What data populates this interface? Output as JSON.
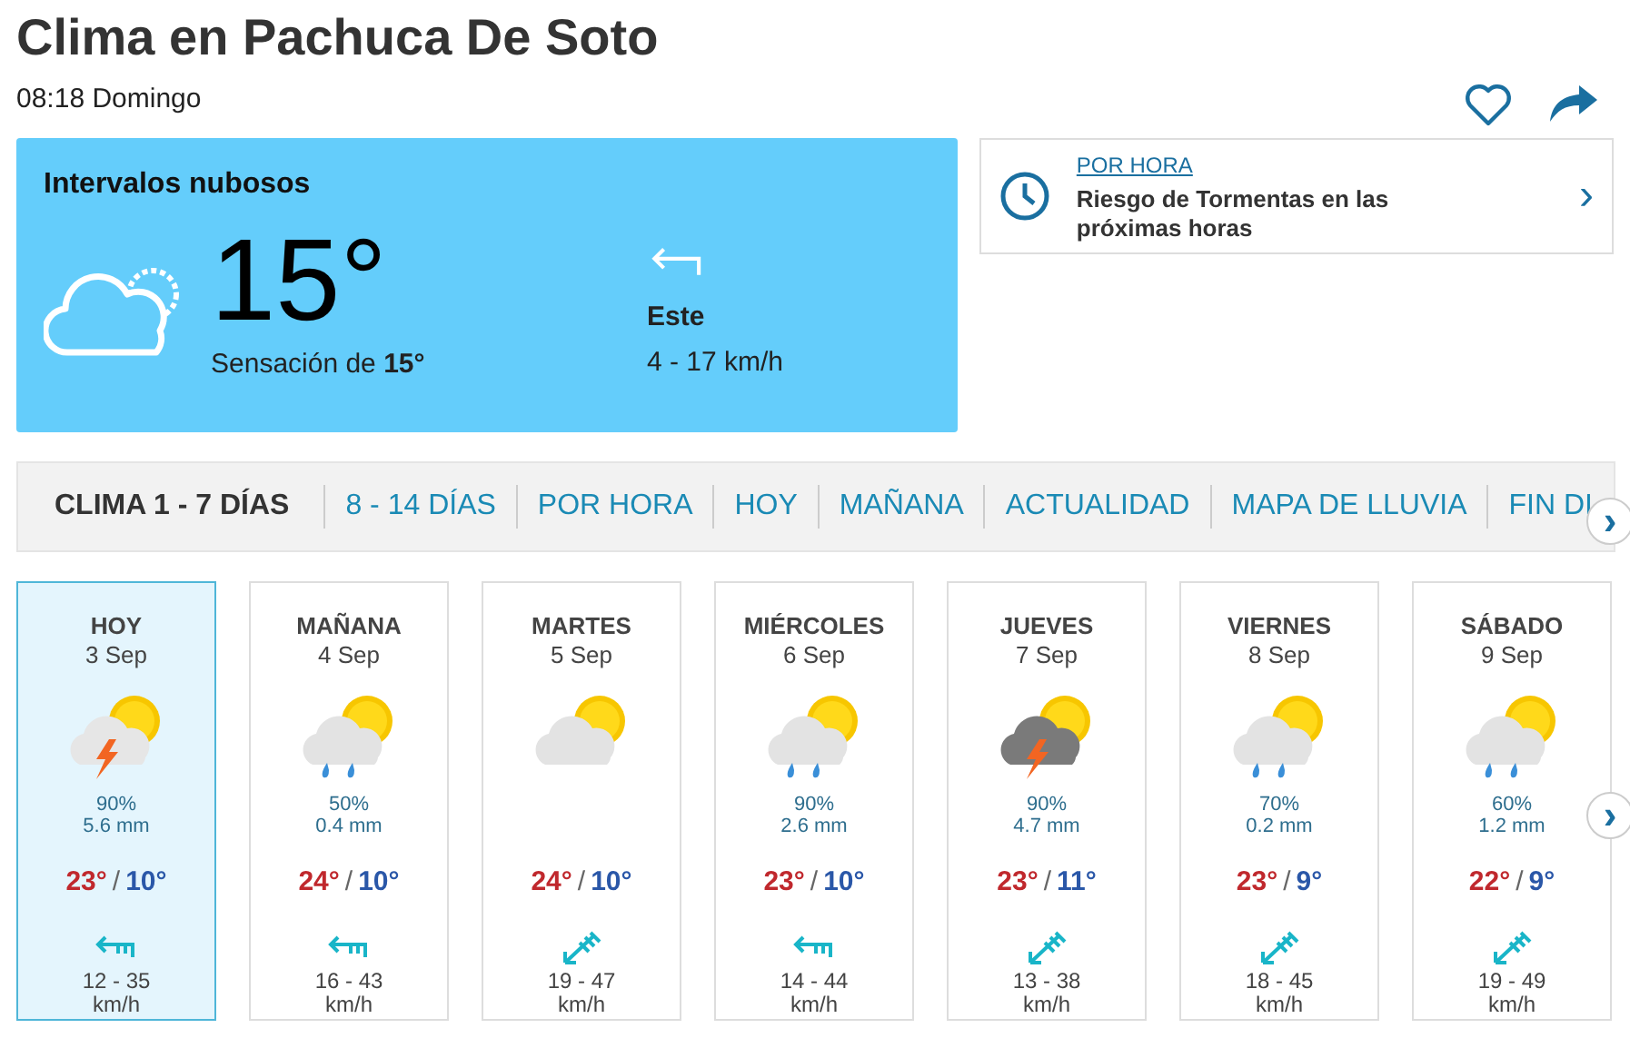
{
  "title": "Clima en Pachuca De Soto",
  "time": "08:18 Domingo",
  "current": {
    "condition": "Intervalos nubosos",
    "icon": {
      "kind": "cloud_sun"
    },
    "temperature": "15°",
    "feels_label": "Sensación de **15°**",
    "wind_direction": "Este",
    "wind_arrow": {
      "kind": "left"
    },
    "wind_speed": "4 - 17 km/h"
  },
  "hourly_card": {
    "link": "POR HORA",
    "message": "Riesgo de Tormentas en las próximas horas",
    "chevron": "›"
  },
  "tabs": [
    {
      "label": "CLIMA 1 - 7 DÍAS",
      "selected": true
    },
    {
      "label": "8 - 14 DÍAS",
      "selected": false
    },
    {
      "label": "POR HORA",
      "selected": false
    },
    {
      "label": "HOY",
      "selected": false
    },
    {
      "label": "MAÑANA",
      "selected": false
    },
    {
      "label": "ACTUALIDAD",
      "selected": false
    },
    {
      "label": "MAPA DE LLUVIA",
      "selected": false
    },
    {
      "label": "FIN DI",
      "selected": false
    }
  ],
  "tabs_next": "›",
  "days": [
    {
      "day": "HOY",
      "date": "3 Sep",
      "icon": {
        "kind": "storm_sun"
      },
      "rain_chance": "90%",
      "rain_amount": "5.6 mm",
      "high": "23°",
      "separator": "/",
      "low": "10°",
      "wind_arrow": {
        "kind": "left"
      },
      "wind": "12 - 35",
      "wind_unit": "km/h",
      "selected": true
    },
    {
      "day": "MAÑANA",
      "date": "4 Sep",
      "icon": {
        "kind": "rain_sun"
      },
      "rain_chance": "50%",
      "rain_amount": "0.4 mm",
      "high": "24°",
      "separator": "/",
      "low": "10°",
      "wind_arrow": {
        "kind": "left"
      },
      "wind": "16 - 43",
      "wind_unit": "km/h",
      "selected": false
    },
    {
      "day": "MARTES",
      "date": "5 Sep",
      "icon": {
        "kind": "cloud_sun"
      },
      "high": "24°",
      "separator": "/",
      "low": "10°",
      "wind_arrow": {
        "kind": "down_left"
      },
      "wind": "19 - 47",
      "wind_unit": "km/h",
      "selected": false
    },
    {
      "day": "MIÉRCOLES",
      "date": "6 Sep",
      "icon": {
        "kind": "rain_sun"
      },
      "rain_chance": "90%",
      "rain_amount": "2.6 mm",
      "high": "23°",
      "separator": "/",
      "low": "10°",
      "wind_arrow": {
        "kind": "left"
      },
      "wind": "14 - 44",
      "wind_unit": "km/h",
      "selected": false
    },
    {
      "day": "JUEVES",
      "date": "7 Sep",
      "icon": {
        "kind": "storm_dark"
      },
      "rain_chance": "90%",
      "rain_amount": "4.7 mm",
      "high": "23°",
      "separator": "/",
      "low": "11°",
      "wind_arrow": {
        "kind": "down_left"
      },
      "wind": "13 - 38",
      "wind_unit": "km/h",
      "selected": false
    },
    {
      "day": "VIERNES",
      "date": "8 Sep",
      "icon": {
        "kind": "rain_sun"
      },
      "rain_chance": "70%",
      "rain_amount": "0.2 mm",
      "high": "23°",
      "separator": "/",
      "low": "9°",
      "wind_arrow": {
        "kind": "down_left"
      },
      "wind": "18 - 45",
      "wind_unit": "km/h",
      "selected": false
    },
    {
      "day": "SÁBADO",
      "date": "9 Sep",
      "icon": {
        "kind": "rain_sun"
      },
      "rain_chance": "60%",
      "rain_amount": "1.2 mm",
      "high": "22°",
      "separator": "/",
      "low": "9°",
      "wind_arrow": {
        "kind": "down_left"
      },
      "wind": "19 - 49",
      "wind_unit": "km/h",
      "selected": false
    }
  ],
  "days_next": "›"
}
